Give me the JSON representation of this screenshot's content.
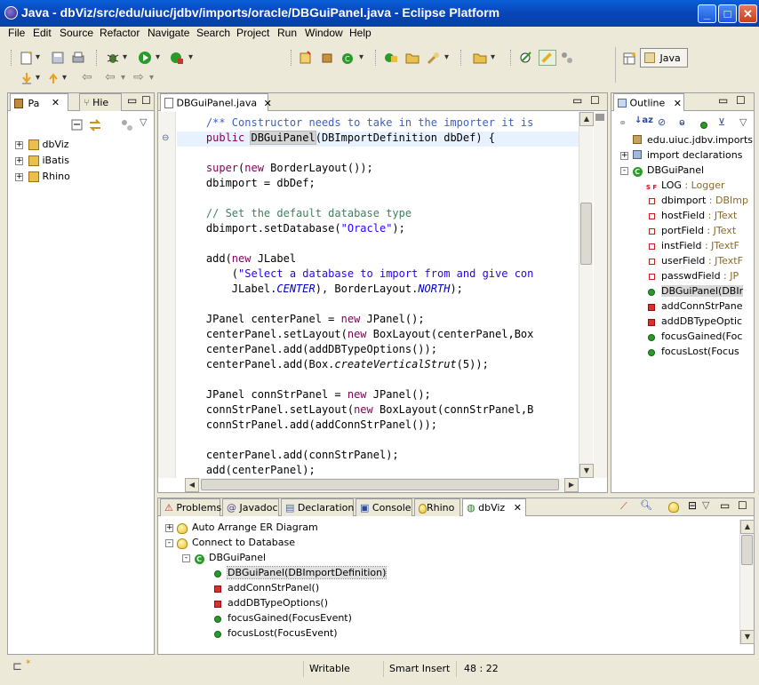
{
  "window": {
    "title": "Java - dbViz/src/edu/uiuc/jdbv/imports/oracle/DBGuiPanel.java - Eclipse Platform"
  },
  "menu": [
    "File",
    "Edit",
    "Source",
    "Refactor",
    "Navigate",
    "Search",
    "Project",
    "Run",
    "Window",
    "Help"
  ],
  "perspective": {
    "label": "Java"
  },
  "left_panel": {
    "tabs": [
      "Pa",
      "Hie"
    ],
    "projects": [
      "dbViz",
      "iBatis",
      "Rhino"
    ]
  },
  "editor": {
    "tab": "DBGuiPanel.java",
    "lines": [
      {
        "parts": [
          [
            "jd",
            "    /** Constructor needs to take in the importer it is"
          ]
        ]
      },
      {
        "parts": [
          [
            "kw",
            "    public "
          ],
          [
            "hl",
            "DBGuiPanel"
          ],
          [
            "",
            "(DBImportDefinition dbDef) {"
          ]
        ],
        "current": true
      },
      {
        "parts": []
      },
      {
        "parts": [
          [
            "kw",
            "    super"
          ],
          [
            "",
            "("
          ],
          [
            "kw",
            "new"
          ],
          [
            "",
            " BorderLayout());"
          ]
        ]
      },
      {
        "parts": [
          [
            "",
            "    dbimport = dbDef;"
          ]
        ]
      },
      {
        "parts": []
      },
      {
        "parts": [
          [
            "cm",
            "    // Set the default database type"
          ]
        ]
      },
      {
        "parts": [
          [
            "",
            "    dbimport.setDatabase("
          ],
          [
            "st",
            "\"Oracle\""
          ],
          [
            "",
            ");"
          ]
        ]
      },
      {
        "parts": []
      },
      {
        "parts": [
          [
            "",
            "    add("
          ],
          [
            "kw",
            "new"
          ],
          [
            "",
            " JLabel"
          ]
        ]
      },
      {
        "parts": [
          [
            "",
            "        ("
          ],
          [
            "st",
            "\"Select a database to import from and give con"
          ]
        ]
      },
      {
        "parts": [
          [
            "",
            "        JLabel."
          ],
          [
            "it",
            "CENTER"
          ],
          [
            "",
            "), BorderLayout."
          ],
          [
            "it",
            "NORTH"
          ],
          [
            "",
            ");"
          ]
        ]
      },
      {
        "parts": []
      },
      {
        "parts": [
          [
            "",
            "    JPanel centerPanel = "
          ],
          [
            "kw",
            "new"
          ],
          [
            "",
            " JPanel();"
          ]
        ]
      },
      {
        "parts": [
          [
            "",
            "    centerPanel.setLayout("
          ],
          [
            "kw",
            "new"
          ],
          [
            "",
            " BoxLayout(centerPanel,Box"
          ]
        ]
      },
      {
        "parts": [
          [
            "",
            "    centerPanel.add(addDBTypeOptions());"
          ]
        ]
      },
      {
        "parts": [
          [
            "",
            "    centerPanel.add(Box."
          ],
          [
            "i",
            "createVerticalStrut"
          ],
          [
            "",
            "(5));"
          ]
        ]
      },
      {
        "parts": []
      },
      {
        "parts": [
          [
            "",
            "    JPanel connStrPanel = "
          ],
          [
            "kw",
            "new"
          ],
          [
            "",
            " JPanel();"
          ]
        ]
      },
      {
        "parts": [
          [
            "",
            "    connStrPanel.setLayout("
          ],
          [
            "kw",
            "new"
          ],
          [
            "",
            " BoxLayout(connStrPanel,B"
          ]
        ]
      },
      {
        "parts": [
          [
            "",
            "    connStrPanel.add(addConnStrPanel());"
          ]
        ]
      },
      {
        "parts": []
      },
      {
        "parts": [
          [
            "",
            "    centerPanel.add(connStrPanel);"
          ]
        ]
      },
      {
        "parts": [
          [
            "",
            "    add(centerPanel);"
          ]
        ]
      }
    ]
  },
  "outline": {
    "tab": "Outline",
    "items": [
      {
        "label": "edu.uiuc.jdbv.imports",
        "kind": "pkg",
        "indent": 0
      },
      {
        "label": "import declarations",
        "kind": "imports",
        "indent": 0,
        "expand": "+"
      },
      {
        "label": "DBGuiPanel",
        "kind": "class",
        "indent": 0,
        "expand": "-"
      },
      {
        "label": "LOG",
        "type": " : Logger",
        "kind": "field-static",
        "indent": 1
      },
      {
        "label": "dbimport",
        "type": " : DBImp",
        "kind": "field",
        "indent": 1
      },
      {
        "label": "hostField",
        "type": " : JText",
        "kind": "field",
        "indent": 1
      },
      {
        "label": "portField",
        "type": " : JText",
        "kind": "field",
        "indent": 1
      },
      {
        "label": "instField",
        "type": " : JTextF",
        "kind": "field",
        "indent": 1
      },
      {
        "label": "userField",
        "type": " : JTextF",
        "kind": "field",
        "indent": 1
      },
      {
        "label": "passwdField",
        "type": " : JP",
        "kind": "field",
        "indent": 1
      },
      {
        "label": "DBGuiPanel(DBIr",
        "kind": "ctor",
        "indent": 1,
        "selected": true
      },
      {
        "label": "addConnStrPane",
        "kind": "private",
        "indent": 1
      },
      {
        "label": "addDBTypeOptic",
        "kind": "private",
        "indent": 1
      },
      {
        "label": "focusGained(Foc",
        "kind": "public",
        "indent": 1
      },
      {
        "label": "focusLost(Focus",
        "kind": "public",
        "indent": 1
      }
    ]
  },
  "bottom_panel": {
    "tabs": [
      "Problems",
      "Javadoc",
      "Declaration",
      "Console",
      "Rhino",
      "dbViz"
    ],
    "tree": [
      {
        "label": "Auto Arrange ER Diagram",
        "kind": "bulb",
        "indent": 0,
        "expand": "+"
      },
      {
        "label": "Connect to Database",
        "kind": "bulb",
        "indent": 0,
        "expand": "-"
      },
      {
        "label": "DBGuiPanel",
        "kind": "class",
        "indent": 1,
        "expand": "-"
      },
      {
        "label": "DBGuiPanel(DBImportDefinition)",
        "kind": "public",
        "indent": 2,
        "selected": true
      },
      {
        "label": "addConnStrPanel()",
        "kind": "private",
        "indent": 2
      },
      {
        "label": "addDBTypeOptions()",
        "kind": "private",
        "indent": 2
      },
      {
        "label": "focusGained(FocusEvent)",
        "kind": "public",
        "indent": 2
      },
      {
        "label": "focusLost(FocusEvent)",
        "kind": "public",
        "indent": 2
      }
    ]
  },
  "status": {
    "writable": "Writable",
    "insert_mode": "Smart Insert",
    "position": "48 : 22"
  }
}
